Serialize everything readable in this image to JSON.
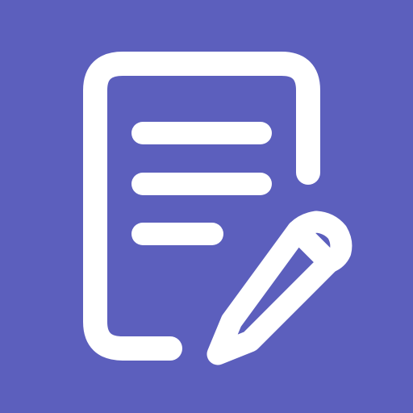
{
  "icon": {
    "name": "document-edit-icon",
    "background_color": "#5c5fbd",
    "foreground_color": "#ffffff"
  }
}
